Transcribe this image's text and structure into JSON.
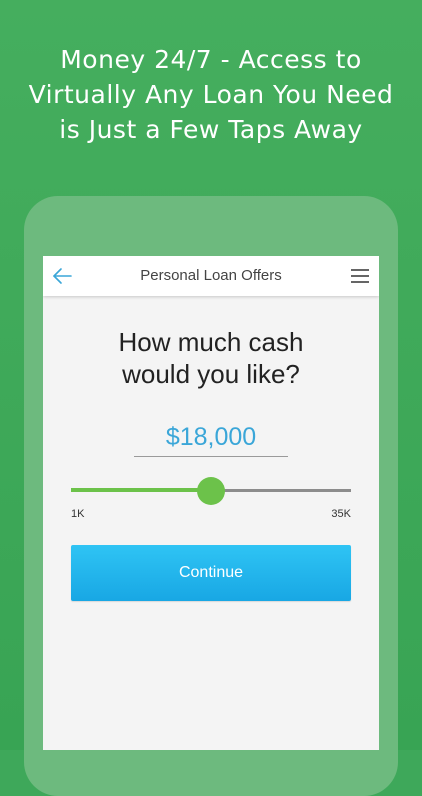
{
  "headline": {
    "line1": "Money 24/7 - Access to",
    "line2": "Virtually Any Loan You Need",
    "line3": "is Just a Few Taps Away"
  },
  "app_bar": {
    "title": "Personal Loan Offers",
    "back_icon": "arrow-left-icon",
    "menu_icon": "hamburger-menu-icon"
  },
  "question": {
    "line1": "How much cash",
    "line2": "would you like?"
  },
  "amount": {
    "value": "$18,000"
  },
  "slider": {
    "min_label": "1K",
    "max_label": "35K",
    "min": 1000,
    "max": 35000,
    "value": 18000
  },
  "continue_label": "Continue",
  "colors": {
    "background": "#3ea85a",
    "accent_blue": "#3aa6d8",
    "slider_green": "#6cc24a",
    "button": "#18a7e4"
  }
}
